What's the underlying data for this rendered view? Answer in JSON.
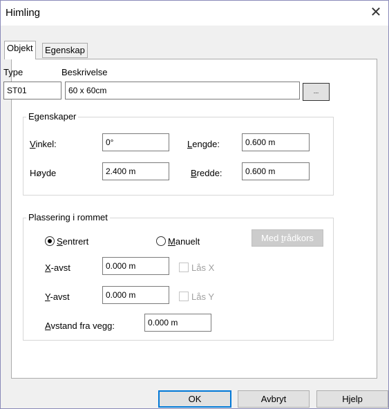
{
  "window": {
    "title": "Himling",
    "close_glyph": "✕"
  },
  "tabs": [
    {
      "label": "Objekt",
      "active": true
    },
    {
      "label": "Egenskap",
      "active": false
    }
  ],
  "header": {
    "type_label": "Type",
    "desc_label": "Beskrivelse",
    "type_value": "ST01",
    "desc_value": "60 x 60cm",
    "browse_label": "..."
  },
  "egenskaper": {
    "title": "Egenskaper",
    "vinkel": {
      "accel": "V",
      "rest": "inkel:",
      "value": "0°"
    },
    "lengde": {
      "accel": "L",
      "rest": "engde:",
      "value": "0.600 m"
    },
    "hoyde": {
      "label": "Høyde",
      "value": "2.400 m"
    },
    "bredde": {
      "accel": "B",
      "rest": "redde:",
      "value": "0.600 m"
    }
  },
  "plassering": {
    "title": "Plassering i rommet",
    "sentrert": {
      "accel": "S",
      "rest": "entrert",
      "checked": true
    },
    "manuelt": {
      "accel": "M",
      "rest": "anuelt",
      "checked": false
    },
    "med_tradkors": {
      "pre": "Med ",
      "accel": "t",
      "rest": "rådkors"
    },
    "x_avst": {
      "accel": "X",
      "rest": "-avst",
      "value": "0.000 m"
    },
    "y_avst": {
      "accel": "Y",
      "rest": "-avst",
      "value": "0.000 m"
    },
    "las_x": "Lås X",
    "las_y": "Lås Y",
    "avstand": {
      "accel": "A",
      "rest": "vstand fra vegg:",
      "value": "0.000 m"
    }
  },
  "buttons": {
    "ok": "OK",
    "avbryt": "Avbryt",
    "hjelp": "Hjelp"
  },
  "colors": {
    "default_button_border": "#0078d7",
    "disabled_button_bg": "#cccccc"
  }
}
